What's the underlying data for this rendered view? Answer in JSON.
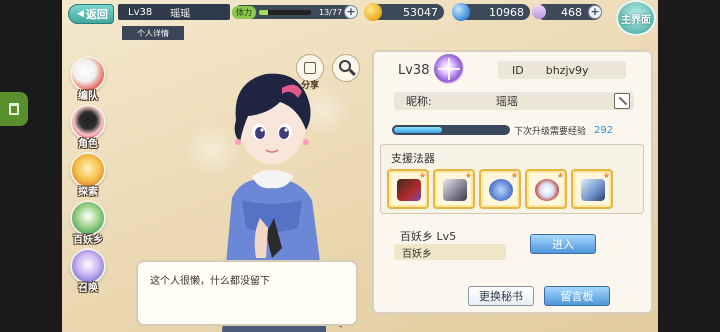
{
  "app": {
    "back_label": "返回",
    "home_label": "主界面",
    "level_short": "Lv38",
    "player_name": "瑶瑶",
    "tab_label": "个人详情"
  },
  "resources": {
    "stamina_label": "体力",
    "stamina_value": "13/77",
    "stamina_fraction": 0.17,
    "coin_value": "53047",
    "gem_value": "10968",
    "crystal_value": "468"
  },
  "sidenav": [
    {
      "label": "编队",
      "icon": "team-icon"
    },
    {
      "label": "角色",
      "icon": "character-icon"
    },
    {
      "label": "探索",
      "icon": "explore-icon"
    },
    {
      "label": "百妖乡",
      "icon": "village-icon"
    },
    {
      "label": "召唤",
      "icon": "summon-icon"
    }
  ],
  "actions": {
    "share_label": "分享"
  },
  "bubble_text": "这个人很懒，什么都没留下",
  "profile": {
    "level": "Lv38",
    "id_label": "ID",
    "id_value": "bhzjv9y",
    "nick_label": "昵称:",
    "nick_value": "瑶瑶",
    "exp_label": "下次升级需要经验",
    "exp_value": "292",
    "exp_fraction": 0.42,
    "fabao_title": "支援法器",
    "fabao_items": [
      "weapon-scroll-icon",
      "bow-icon",
      "talisman-icon",
      "bell-icon",
      "trident-icon"
    ],
    "village_label": "百妖乡  Lv5",
    "village_name": "百妖乡",
    "enter_btn": "进入",
    "change_secretary_btn": "更换秘书",
    "message_board_btn": "留言板"
  },
  "colors": {
    "accent_teal": "#3fa6a0",
    "button_blue": "#4e95d8",
    "exp_blue": "#2b8ad8"
  }
}
